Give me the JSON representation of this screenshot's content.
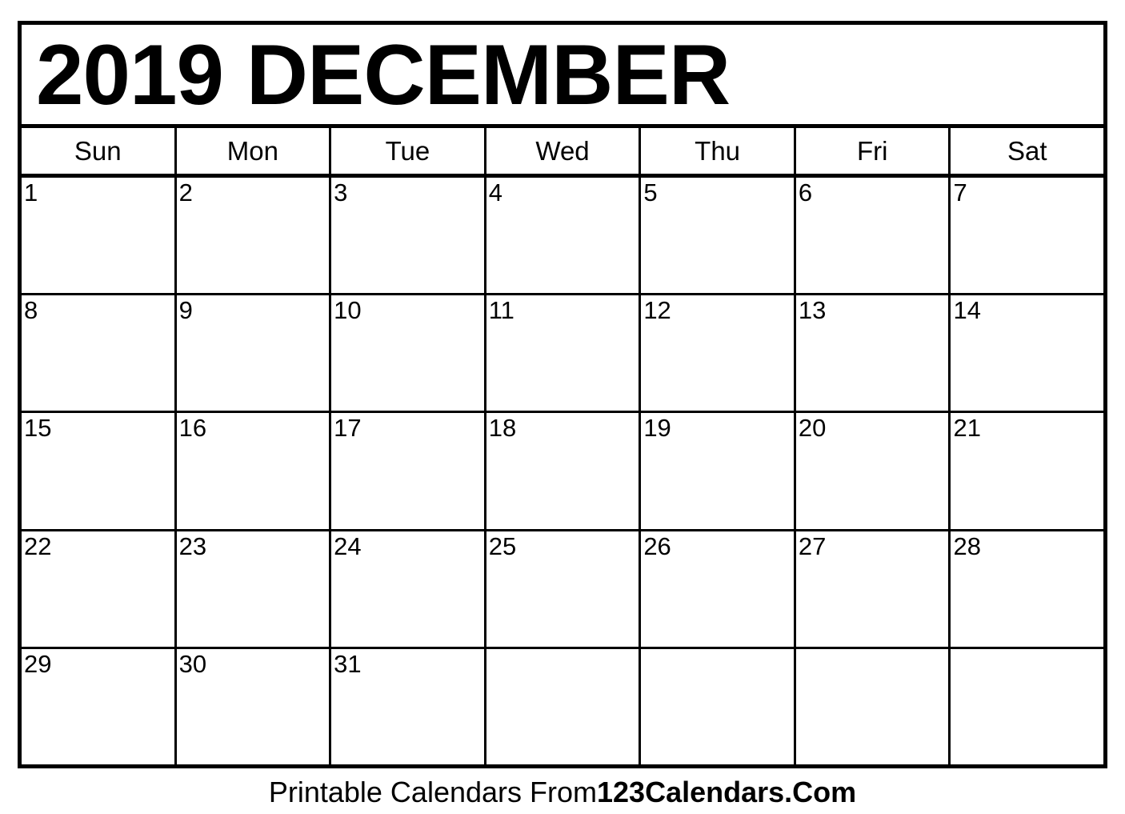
{
  "document": {
    "type": "printable-calendar",
    "title": "2019 DECEMBER",
    "year": "2019",
    "month": "DECEMBER"
  },
  "weekdays": [
    {
      "label": "Sun"
    },
    {
      "label": "Mon"
    },
    {
      "label": "Tue"
    },
    {
      "label": "Wed"
    },
    {
      "label": "Thu"
    },
    {
      "label": "Fri"
    },
    {
      "label": "Sat"
    }
  ],
  "weeks": [
    {
      "days": [
        {
          "date": "1"
        },
        {
          "date": "2"
        },
        {
          "date": "3"
        },
        {
          "date": "4"
        },
        {
          "date": "5"
        },
        {
          "date": "6"
        },
        {
          "date": "7"
        }
      ]
    },
    {
      "days": [
        {
          "date": "8"
        },
        {
          "date": "9"
        },
        {
          "date": "10"
        },
        {
          "date": "11"
        },
        {
          "date": "12"
        },
        {
          "date": "13"
        },
        {
          "date": "14"
        }
      ]
    },
    {
      "days": [
        {
          "date": "15"
        },
        {
          "date": "16"
        },
        {
          "date": "17"
        },
        {
          "date": "18"
        },
        {
          "date": "19"
        },
        {
          "date": "20"
        },
        {
          "date": "21"
        }
      ]
    },
    {
      "days": [
        {
          "date": "22"
        },
        {
          "date": "23"
        },
        {
          "date": "24"
        },
        {
          "date": "25"
        },
        {
          "date": "26"
        },
        {
          "date": "27"
        },
        {
          "date": "28"
        }
      ]
    },
    {
      "days": [
        {
          "date": "29"
        },
        {
          "date": "30"
        },
        {
          "date": "31"
        },
        {
          "date": ""
        },
        {
          "date": ""
        },
        {
          "date": ""
        },
        {
          "date": ""
        }
      ]
    }
  ],
  "footer": {
    "prefix": "Printable Calendars From ",
    "brand": "123Calendars.Com"
  },
  "colors": {
    "ink": "#000000",
    "paper": "#ffffff"
  }
}
